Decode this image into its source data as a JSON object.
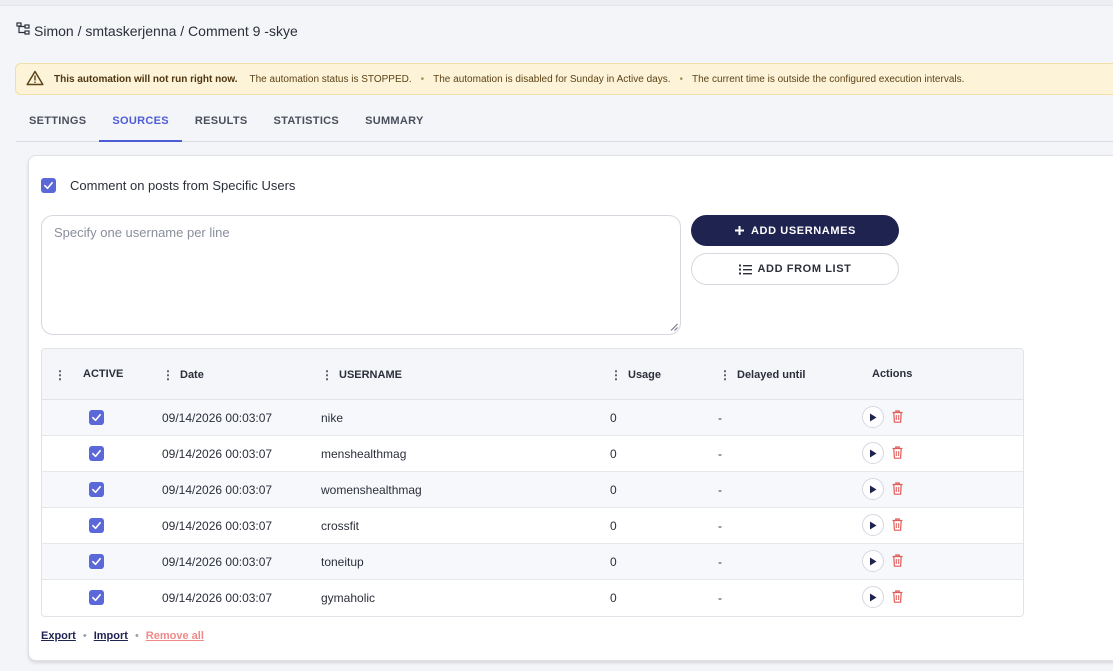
{
  "breadcrumb": {
    "text": "Simon / smtaskerjenna / Comment 9 -skye",
    "icon": "sitemap-icon"
  },
  "alert": {
    "title": "This automation will not run right now.",
    "messages": [
      "The automation status is STOPPED.",
      "The automation is disabled for Sunday in Active days.",
      "The current time is outside the configured execution intervals."
    ],
    "separator": "•",
    "icon": "warning-icon",
    "color": "#fdf3d8"
  },
  "tabs": [
    {
      "label": "SETTINGS",
      "active": false
    },
    {
      "label": "SOURCES",
      "active": true
    },
    {
      "label": "RESULTS",
      "active": false
    },
    {
      "label": "STATISTICS",
      "active": false
    },
    {
      "label": "SUMMARY",
      "active": false
    }
  ],
  "source": {
    "option_label": "Comment on posts from Specific Users",
    "option_checked": true,
    "textarea_placeholder": "Specify one username per line",
    "add_usernames_label": "ADD USERNAMES",
    "add_from_list_label": "ADD FROM LIST"
  },
  "table": {
    "headers": {
      "active": "ACTIVE",
      "date": "Date",
      "username": "USERNAME",
      "usage": "Usage",
      "delayed": "Delayed until",
      "actions": "Actions"
    },
    "rows": [
      {
        "active": true,
        "date": "09/14/2026 00:03:07",
        "username": "nike",
        "usage": "0",
        "delayed": "-"
      },
      {
        "active": true,
        "date": "09/14/2026 00:03:07",
        "username": "menshealthmag",
        "usage": "0",
        "delayed": "-"
      },
      {
        "active": true,
        "date": "09/14/2026 00:03:07",
        "username": "womenshealthmag",
        "usage": "0",
        "delayed": "-"
      },
      {
        "active": true,
        "date": "09/14/2026 00:03:07",
        "username": "crossfit",
        "usage": "0",
        "delayed": "-"
      },
      {
        "active": true,
        "date": "09/14/2026 00:03:07",
        "username": "toneitup",
        "usage": "0",
        "delayed": "-"
      },
      {
        "active": true,
        "date": "09/14/2026 00:03:07",
        "username": "gymaholic",
        "usage": "0",
        "delayed": "-"
      }
    ]
  },
  "footer": {
    "export": "Export",
    "import": "Import",
    "remove_all": "Remove all",
    "separator": "•"
  },
  "colors": {
    "accent": "#5b68d9",
    "primary_button": "#1f2350",
    "danger": "#e25b58",
    "alert_bg": "#fdf3d8"
  }
}
